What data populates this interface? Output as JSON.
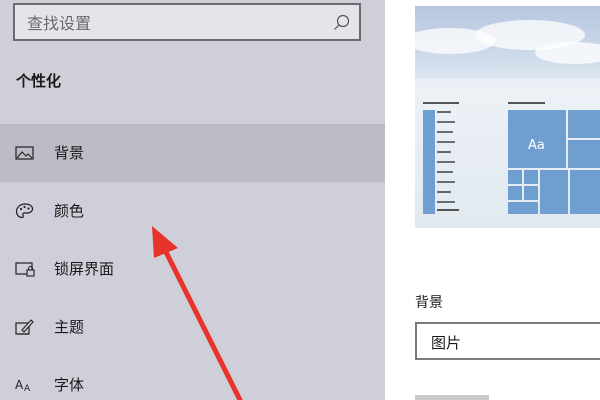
{
  "sidebar": {
    "search": {
      "placeholder": "查找设置",
      "icon": "search-icon"
    },
    "section_title": "个性化",
    "items": [
      {
        "label": "背景",
        "icon": "image-icon",
        "selected": true
      },
      {
        "label": "颜色",
        "icon": "palette-icon",
        "selected": false
      },
      {
        "label": "锁屏界面",
        "icon": "lock-screen-icon",
        "selected": false
      },
      {
        "label": "主题",
        "icon": "theme-icon",
        "selected": false
      },
      {
        "label": "字体",
        "icon": "font-icon",
        "selected": false
      }
    ]
  },
  "main": {
    "preview": {
      "sample_text": "Aa"
    },
    "background_label": "背景",
    "background_dropdown": {
      "value": "图片"
    }
  },
  "colors": {
    "sidebar_bg": "#cfcfd9",
    "selected_item_bg": "#bcbcc6",
    "tile_accent": "#6f9fd0",
    "annotation_arrow": "#e8332a"
  }
}
